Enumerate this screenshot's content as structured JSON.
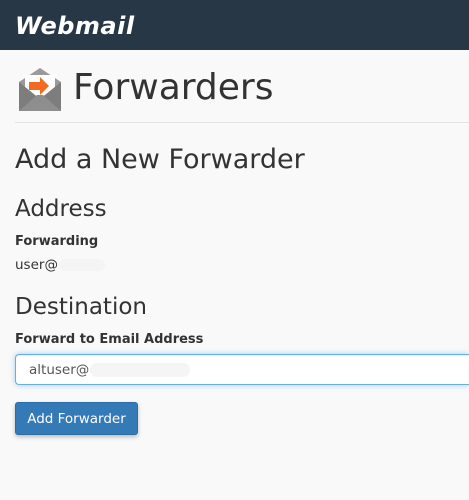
{
  "topbar": {
    "logo_text": "Webmail"
  },
  "header": {
    "title": "Forwarders",
    "icon": "envelope-forward-icon"
  },
  "form": {
    "section_title": "Add a New Forwarder",
    "address": {
      "heading": "Address",
      "forwarding_label": "Forwarding",
      "forwarding_value": "user@"
    },
    "destination": {
      "heading": "Destination",
      "field_label": "Forward to Email Address",
      "field_value": "altuser@"
    },
    "submit_label": "Add Forwarder"
  },
  "colors": {
    "topbar_bg": "#283746",
    "primary_button": "#337ab7",
    "accent_arrow": "#f26b21",
    "focus_border": "#66afe9"
  }
}
